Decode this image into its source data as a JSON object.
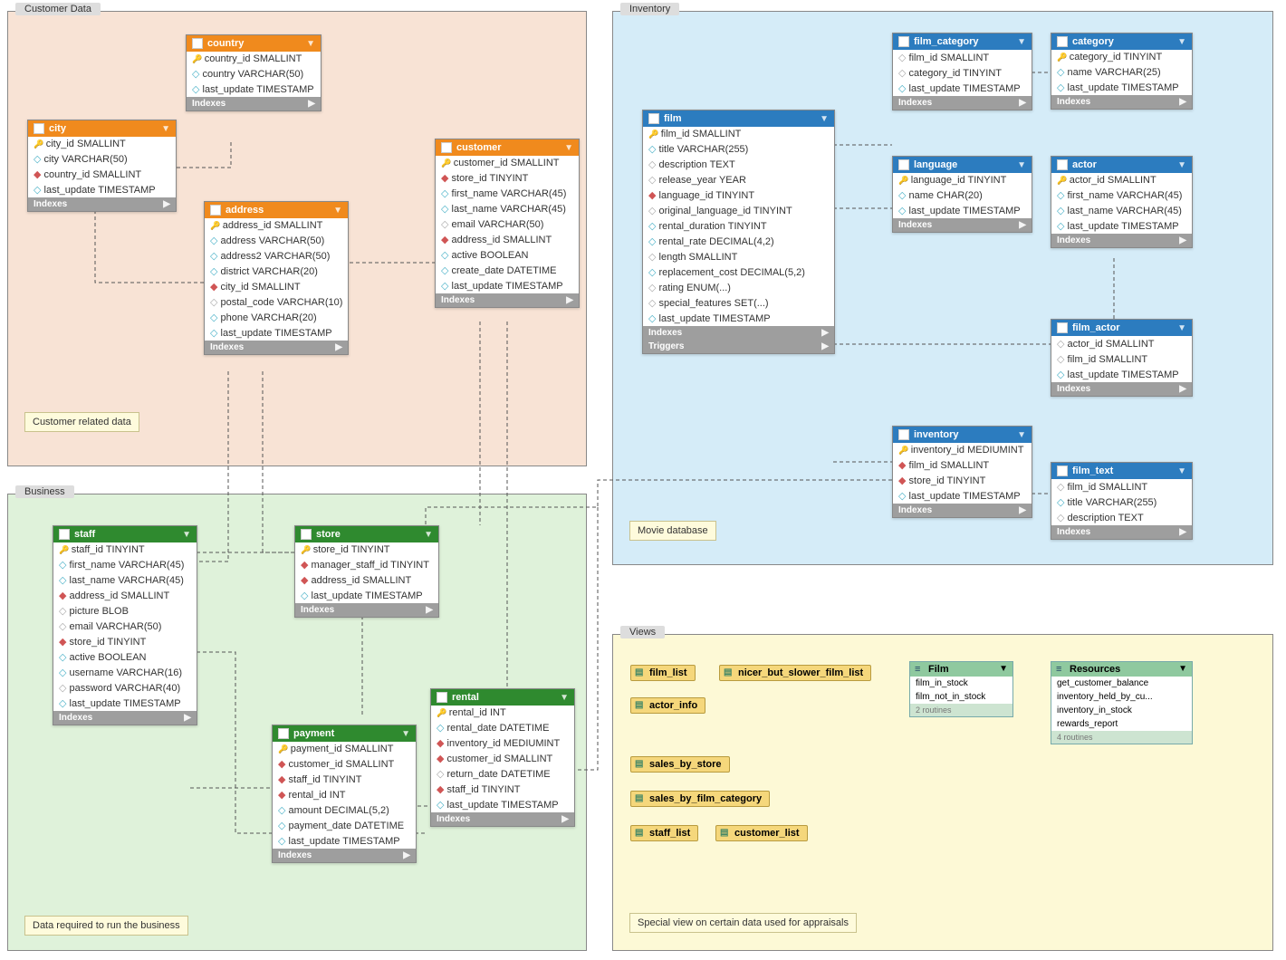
{
  "regions": {
    "customer": {
      "label": "Customer Data",
      "note": "Customer related data"
    },
    "inventory": {
      "label": "Inventory",
      "note": "Movie database"
    },
    "business": {
      "label": "Business",
      "note": "Data required to run the business"
    },
    "views": {
      "label": "Views",
      "note": "Special view on certain data used for appraisals"
    }
  },
  "tables": {
    "country": {
      "title": "country",
      "columns": [
        {
          "t": "pk",
          "s": "country_id SMALLINT"
        },
        {
          "t": "ix",
          "s": "country VARCHAR(50)"
        },
        {
          "t": "ix",
          "s": "last_update TIMESTAMP"
        }
      ],
      "footers": [
        "Indexes"
      ]
    },
    "city": {
      "title": "city",
      "columns": [
        {
          "t": "pk",
          "s": "city_id SMALLINT"
        },
        {
          "t": "ix",
          "s": "city VARCHAR(50)"
        },
        {
          "t": "fk",
          "s": "country_id SMALLINT"
        },
        {
          "t": "ix",
          "s": "last_update TIMESTAMP"
        }
      ],
      "footers": [
        "Indexes"
      ]
    },
    "address": {
      "title": "address",
      "columns": [
        {
          "t": "pk",
          "s": "address_id SMALLINT"
        },
        {
          "t": "ix",
          "s": "address VARCHAR(50)"
        },
        {
          "t": "ix",
          "s": "address2 VARCHAR(50)"
        },
        {
          "t": "ix",
          "s": "district VARCHAR(20)"
        },
        {
          "t": "fk",
          "s": "city_id SMALLINT"
        },
        {
          "t": "pl",
          "s": "postal_code VARCHAR(10)"
        },
        {
          "t": "ix",
          "s": "phone VARCHAR(20)"
        },
        {
          "t": "ix",
          "s": "last_update TIMESTAMP"
        }
      ],
      "footers": [
        "Indexes"
      ]
    },
    "customer": {
      "title": "customer",
      "columns": [
        {
          "t": "pk",
          "s": "customer_id SMALLINT"
        },
        {
          "t": "fk",
          "s": "store_id TINYINT"
        },
        {
          "t": "ix",
          "s": "first_name VARCHAR(45)"
        },
        {
          "t": "ix",
          "s": "last_name VARCHAR(45)"
        },
        {
          "t": "pl",
          "s": "email VARCHAR(50)"
        },
        {
          "t": "fk",
          "s": "address_id SMALLINT"
        },
        {
          "t": "ix",
          "s": "active BOOLEAN"
        },
        {
          "t": "ix",
          "s": "create_date DATETIME"
        },
        {
          "t": "ix",
          "s": "last_update TIMESTAMP"
        }
      ],
      "footers": [
        "Indexes"
      ]
    },
    "film": {
      "title": "film",
      "columns": [
        {
          "t": "pk",
          "s": "film_id SMALLINT"
        },
        {
          "t": "ix",
          "s": "title VARCHAR(255)"
        },
        {
          "t": "pl",
          "s": "description TEXT"
        },
        {
          "t": "pl",
          "s": "release_year YEAR"
        },
        {
          "t": "fk",
          "s": "language_id TINYINT"
        },
        {
          "t": "pl",
          "s": "original_language_id TINYINT"
        },
        {
          "t": "ix",
          "s": "rental_duration TINYINT"
        },
        {
          "t": "ix",
          "s": "rental_rate DECIMAL(4,2)"
        },
        {
          "t": "pl",
          "s": "length SMALLINT"
        },
        {
          "t": "ix",
          "s": "replacement_cost DECIMAL(5,2)"
        },
        {
          "t": "pl",
          "s": "rating ENUM(...)"
        },
        {
          "t": "pl",
          "s": "special_features SET(...)"
        },
        {
          "t": "ix",
          "s": "last_update TIMESTAMP"
        }
      ],
      "footers": [
        "Indexes",
        "Triggers"
      ]
    },
    "film_category": {
      "title": "film_category",
      "columns": [
        {
          "t": "pl",
          "s": "film_id SMALLINT"
        },
        {
          "t": "pl",
          "s": "category_id TINYINT"
        },
        {
          "t": "ix",
          "s": "last_update TIMESTAMP"
        }
      ],
      "footers": [
        "Indexes"
      ]
    },
    "category": {
      "title": "category",
      "columns": [
        {
          "t": "pk",
          "s": "category_id TINYINT"
        },
        {
          "t": "ix",
          "s": "name VARCHAR(25)"
        },
        {
          "t": "ix",
          "s": "last_update TIMESTAMP"
        }
      ],
      "footers": [
        "Indexes"
      ]
    },
    "language": {
      "title": "language",
      "columns": [
        {
          "t": "pk",
          "s": "language_id TINYINT"
        },
        {
          "t": "ix",
          "s": "name CHAR(20)"
        },
        {
          "t": "ix",
          "s": "last_update TIMESTAMP"
        }
      ],
      "footers": [
        "Indexes"
      ]
    },
    "actor": {
      "title": "actor",
      "columns": [
        {
          "t": "pk",
          "s": "actor_id SMALLINT"
        },
        {
          "t": "ix",
          "s": "first_name VARCHAR(45)"
        },
        {
          "t": "ix",
          "s": "last_name VARCHAR(45)"
        },
        {
          "t": "ix",
          "s": "last_update TIMESTAMP"
        }
      ],
      "footers": [
        "Indexes"
      ]
    },
    "film_actor": {
      "title": "film_actor",
      "columns": [
        {
          "t": "pl",
          "s": "actor_id SMALLINT"
        },
        {
          "t": "pl",
          "s": "film_id SMALLINT"
        },
        {
          "t": "ix",
          "s": "last_update TIMESTAMP"
        }
      ],
      "footers": [
        "Indexes"
      ]
    },
    "inventory": {
      "title": "inventory",
      "columns": [
        {
          "t": "pk",
          "s": "inventory_id MEDIUMINT"
        },
        {
          "t": "fk",
          "s": "film_id SMALLINT"
        },
        {
          "t": "fk",
          "s": "store_id TINYINT"
        },
        {
          "t": "ix",
          "s": "last_update TIMESTAMP"
        }
      ],
      "footers": [
        "Indexes"
      ]
    },
    "film_text": {
      "title": "film_text",
      "columns": [
        {
          "t": "pl",
          "s": "film_id SMALLINT"
        },
        {
          "t": "ix",
          "s": "title VARCHAR(255)"
        },
        {
          "t": "pl",
          "s": "description TEXT"
        }
      ],
      "footers": [
        "Indexes"
      ]
    },
    "staff": {
      "title": "staff",
      "columns": [
        {
          "t": "pk",
          "s": "staff_id TINYINT"
        },
        {
          "t": "ix",
          "s": "first_name VARCHAR(45)"
        },
        {
          "t": "ix",
          "s": "last_name VARCHAR(45)"
        },
        {
          "t": "fk",
          "s": "address_id SMALLINT"
        },
        {
          "t": "pl",
          "s": "picture BLOB"
        },
        {
          "t": "pl",
          "s": "email VARCHAR(50)"
        },
        {
          "t": "fk",
          "s": "store_id TINYINT"
        },
        {
          "t": "ix",
          "s": "active BOOLEAN"
        },
        {
          "t": "ix",
          "s": "username VARCHAR(16)"
        },
        {
          "t": "pl",
          "s": "password VARCHAR(40)"
        },
        {
          "t": "ix",
          "s": "last_update TIMESTAMP"
        }
      ],
      "footers": [
        "Indexes"
      ]
    },
    "store": {
      "title": "store",
      "columns": [
        {
          "t": "pk",
          "s": "store_id TINYINT"
        },
        {
          "t": "fk",
          "s": "manager_staff_id TINYINT"
        },
        {
          "t": "fk",
          "s": "address_id SMALLINT"
        },
        {
          "t": "ix",
          "s": "last_update TIMESTAMP"
        }
      ],
      "footers": [
        "Indexes"
      ]
    },
    "payment": {
      "title": "payment",
      "columns": [
        {
          "t": "pk",
          "s": "payment_id SMALLINT"
        },
        {
          "t": "fk",
          "s": "customer_id SMALLINT"
        },
        {
          "t": "fk",
          "s": "staff_id TINYINT"
        },
        {
          "t": "fk",
          "s": "rental_id INT"
        },
        {
          "t": "ix",
          "s": "amount DECIMAL(5,2)"
        },
        {
          "t": "ix",
          "s": "payment_date DATETIME"
        },
        {
          "t": "ix",
          "s": "last_update TIMESTAMP"
        }
      ],
      "footers": [
        "Indexes"
      ]
    },
    "rental": {
      "title": "rental",
      "columns": [
        {
          "t": "pk",
          "s": "rental_id INT"
        },
        {
          "t": "ix",
          "s": "rental_date DATETIME"
        },
        {
          "t": "fk",
          "s": "inventory_id MEDIUMINT"
        },
        {
          "t": "fk",
          "s": "customer_id SMALLINT"
        },
        {
          "t": "pl",
          "s": "return_date DATETIME"
        },
        {
          "t": "fk",
          "s": "staff_id TINYINT"
        },
        {
          "t": "ix",
          "s": "last_update TIMESTAMP"
        }
      ],
      "footers": [
        "Indexes"
      ]
    }
  },
  "views": {
    "chips": [
      "film_list",
      "nicer_but_slower_film_list",
      "actor_info",
      "sales_by_store",
      "sales_by_film_category",
      "staff_list",
      "customer_list"
    ],
    "routine_groups": [
      {
        "title": "Film",
        "items": [
          "film_in_stock",
          "film_not_in_stock"
        ],
        "foot": "2 routines"
      },
      {
        "title": "Resources",
        "items": [
          "get_customer_balance",
          "inventory_held_by_cu...",
          "inventory_in_stock",
          "rewards_report"
        ],
        "foot": "4 routines"
      }
    ]
  }
}
